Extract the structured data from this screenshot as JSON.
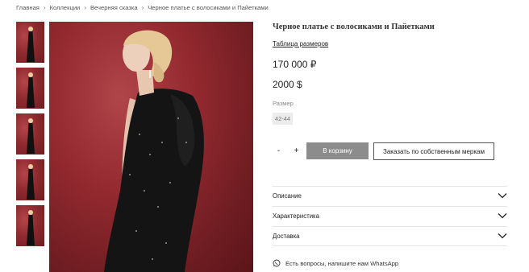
{
  "breadcrumb": {
    "items": [
      "Главная",
      "Коллекции",
      "Вечерняя сказка",
      "Черное платье с волосиками и Пайетками"
    ],
    "separator": "›"
  },
  "product": {
    "title": "Черное платье с волосиками и Пайетками",
    "size_table_link": "Таблица размеров",
    "price_rub": "170 000 ₽",
    "price_usd": "2000 $",
    "size_label": "Размер",
    "sizes": [
      "42-44"
    ]
  },
  "purchase": {
    "minus_label": "-",
    "plus_label": "+",
    "add_to_cart_label": "В корзину",
    "custom_order_label": "Заказать по собственным меркам"
  },
  "accordion": {
    "items": [
      {
        "label": "Описание"
      },
      {
        "label": "Характеристика"
      },
      {
        "label": "Доставка"
      }
    ]
  },
  "contact": {
    "whatsapp_text": "Есть вопросы, напишите нам WhatsApp",
    "icon": "whatsapp-icon"
  },
  "colors": {
    "background_red": "#92292f",
    "cart_button": "#8c8c8c",
    "text": "#222222"
  }
}
